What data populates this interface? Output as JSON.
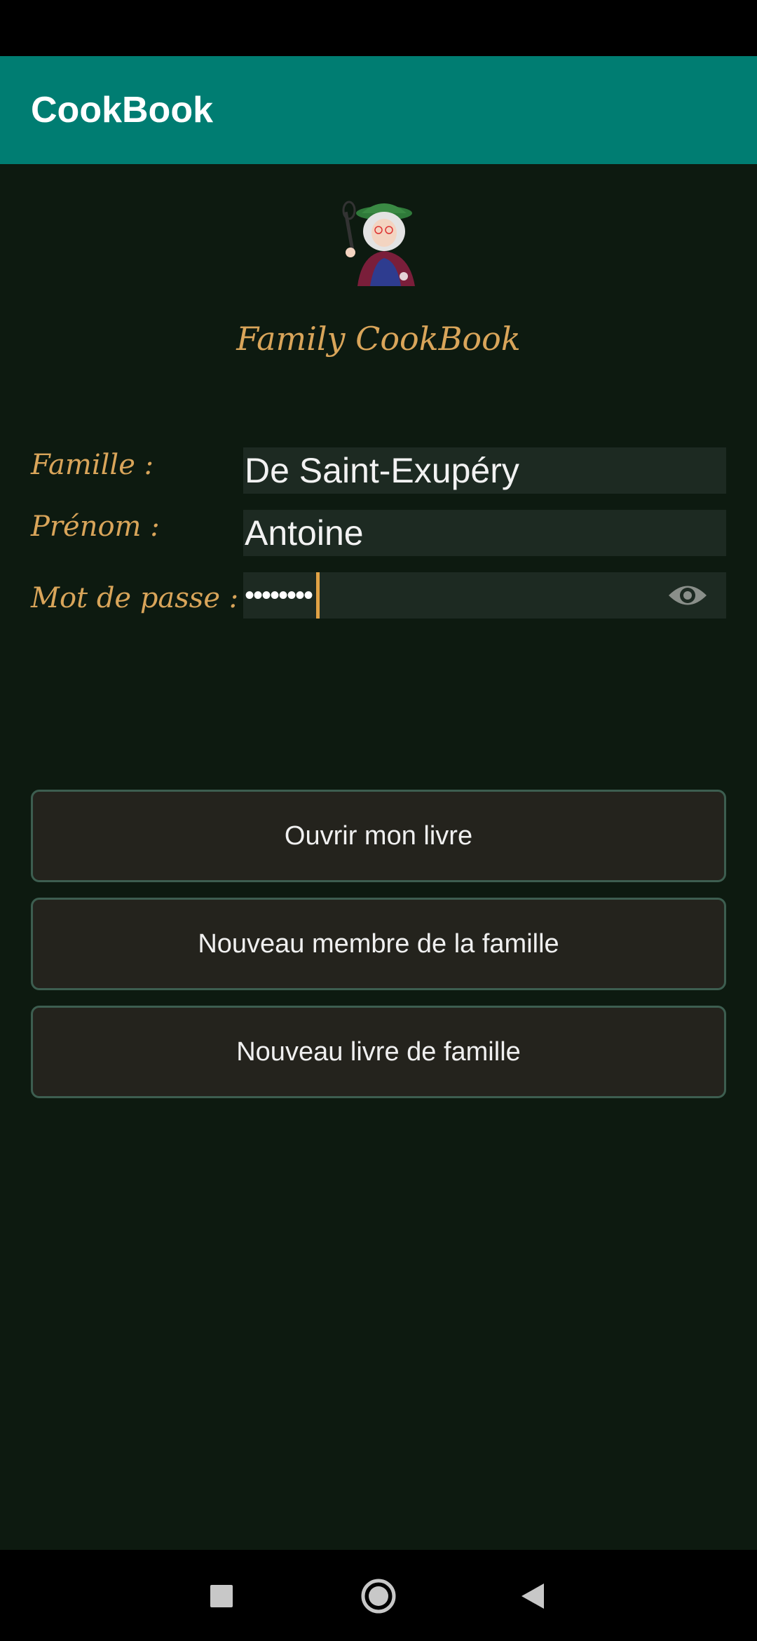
{
  "app_bar": {
    "title": "CookBook"
  },
  "header": {
    "brand_title": "Family CookBook",
    "logo_icon": "grandma-chef-logo"
  },
  "form": {
    "family_label": "Famille :",
    "family_value": "De Saint-Exupéry",
    "firstname_label": "Prénom :",
    "firstname_value": "Antoine",
    "password_label": "Mot de passe :",
    "password_value": "••••••••",
    "password_toggle_icon": "eye-icon"
  },
  "actions": {
    "open_book": "Ouvrir mon livre",
    "new_member": "Nouveau membre de la famille",
    "new_family_book": "Nouveau livre de famille"
  },
  "nav": {
    "recents_icon": "square-icon",
    "home_icon": "circle-icon",
    "back_icon": "triangle-back-icon"
  },
  "colors": {
    "app_bar": "#007d72",
    "background": "#0d1a10",
    "accent_label": "#d9a55a",
    "field_bg": "#1d2a22",
    "button_bg": "#24231d",
    "button_border": "#3d5e50"
  }
}
